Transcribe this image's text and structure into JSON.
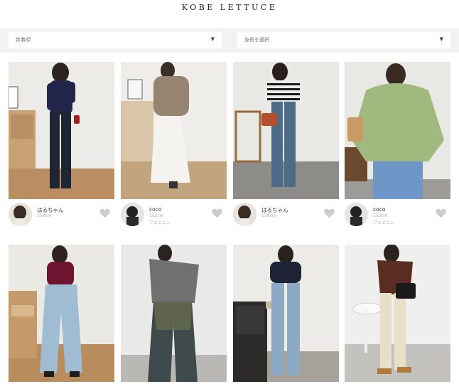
{
  "header": {
    "logo": "KOBE LETTUCE"
  },
  "filters": {
    "sort": {
      "value": "新着順"
    },
    "height": {
      "value": "身長を選択"
    },
    "arrow": "▼"
  },
  "posts": [
    {
      "user": {
        "name": "はるちゃん",
        "height": "158cm",
        "style": ""
      }
    },
    {
      "user": {
        "name": "coco",
        "height": "152cm",
        "style": "フェミニン"
      }
    },
    {
      "user": {
        "name": "はるちゃん",
        "height": "158cm",
        "style": ""
      }
    },
    {
      "user": {
        "name": "coco",
        "height": "152cm",
        "style": "フェミニン"
      }
    },
    {
      "user": null
    },
    {
      "user": null
    },
    {
      "user": null
    },
    {
      "user": null
    }
  ],
  "colors": {
    "filter_bar_bg": "#f2f2f2",
    "heart": "#cccccc"
  },
  "icons": {
    "favorite": "heart-icon",
    "dropdown": "chevron-down-icon"
  }
}
